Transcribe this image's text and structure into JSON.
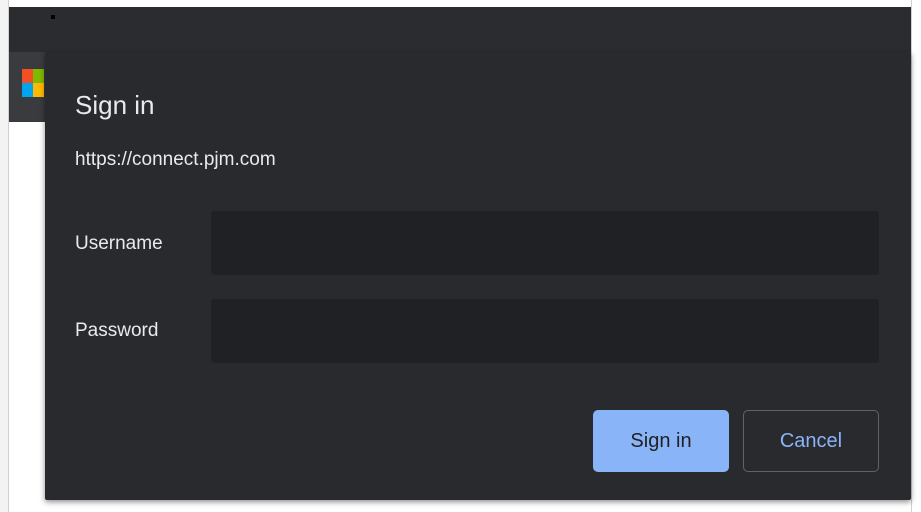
{
  "dialog": {
    "title": "Sign in",
    "url": "https://connect.pjm.com",
    "username_label": "Username",
    "username_value": "",
    "password_label": "Password",
    "password_value": "",
    "signin_label": "Sign in",
    "cancel_label": "Cancel"
  },
  "colors": {
    "dialog_bg": "#292a2d",
    "input_bg": "#202124",
    "accent": "#8ab4f8",
    "text": "#e8eaed"
  },
  "icons": {
    "logo": "microsoft-logo-icon"
  }
}
